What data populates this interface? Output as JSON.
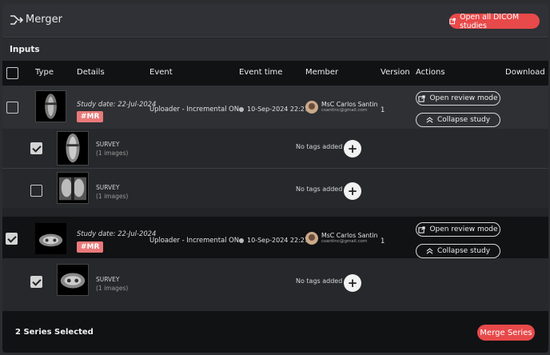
{
  "header": {
    "title": "Merger",
    "open_all_label": "Open all DICOM studies"
  },
  "inputs_label": "Inputs",
  "columns": {
    "type": "Type",
    "details": "Details",
    "event": "Event",
    "event_time": "Event time",
    "member": "Member",
    "version": "Version",
    "actions": "Actions",
    "download": "Download"
  },
  "studies": [
    {
      "checked": false,
      "study_date": "Study date: 22-Jul-2024",
      "tag": "#MR",
      "event": "Uploader - Incremental ON",
      "event_time": "10-Sep-2024 22:27",
      "member_name": "MsC Carlos Santin",
      "member_email": "csantinc@gmail.com",
      "version": "1",
      "open_review_label": "Open review mode",
      "collapse_label": "Collapse study",
      "series": [
        {
          "checked": true,
          "name": "SURVEY",
          "count": "(1 images)",
          "tags": "No tags added"
        },
        {
          "checked": false,
          "name": "SURVEY",
          "count": "(1 images)",
          "tags": "No tags added"
        }
      ]
    },
    {
      "checked": true,
      "study_date": "Study date: 22-Jul-2024",
      "tag": "#MR",
      "event": "Uploader - Incremental ON",
      "event_time": "10-Sep-2024 22:27",
      "member_name": "MsC Carlos Santin",
      "member_email": "csantinc@gmail.com",
      "version": "1",
      "open_review_label": "Open review mode",
      "collapse_label": "Collapse study",
      "series": [
        {
          "checked": true,
          "name": "SURVEY",
          "count": "(1 images)",
          "tags": "No tags added"
        }
      ]
    }
  ],
  "footer": {
    "selected_text": "2 Series Selected",
    "merge_label": "Merge Series"
  },
  "colors": {
    "accent": "#e8494a",
    "tag": "#e8797a"
  },
  "icons": {
    "merge": "merge-arrows-icon",
    "external": "external-link-icon",
    "collapse": "chevron-up-icon",
    "clock": "clock-icon",
    "plus": "plus-icon"
  }
}
